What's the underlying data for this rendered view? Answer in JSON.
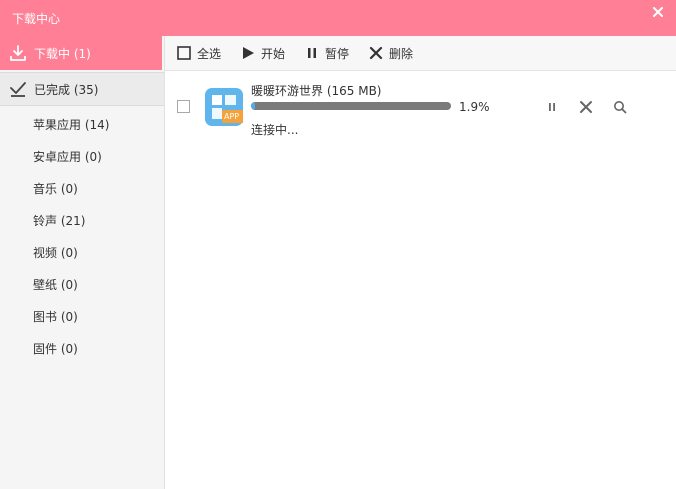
{
  "window": {
    "title": "下载中心"
  },
  "sidebar": {
    "downloading": {
      "label": "下载中 (1)"
    },
    "completed": {
      "label": "已完成 (35)"
    },
    "categories": [
      {
        "label": "苹果应用 (14)"
      },
      {
        "label": "安卓应用 (0)"
      },
      {
        "label": "音乐 (0)"
      },
      {
        "label": "铃声 (21)"
      },
      {
        "label": "视频 (0)"
      },
      {
        "label": "壁纸 (0)"
      },
      {
        "label": "图书 (0)"
      },
      {
        "label": "固件 (0)"
      }
    ]
  },
  "toolbar": {
    "select_all": "全选",
    "start": "开始",
    "pause": "暂停",
    "delete": "删除"
  },
  "downloads": [
    {
      "name": "暖暖环游世界 (165 MB)",
      "progress_percent": 1.9,
      "percent_label": "1.9%",
      "status": "连接中...",
      "icon_badge": "APP"
    }
  ],
  "colors": {
    "accent": "#ff8096",
    "app_icon": "#5fb5ec",
    "app_badge": "#f5a23a",
    "progress_fill": "#59a8e6",
    "progress_track": "#7a7a7a"
  }
}
